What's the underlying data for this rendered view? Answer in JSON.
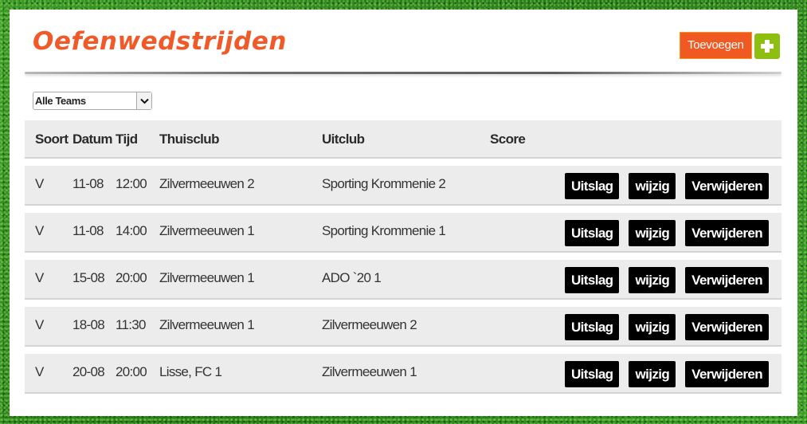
{
  "header": {
    "title": "Oefenwedstrijden",
    "add_button_label": "Toevoegen",
    "add_icon": "plus-icon"
  },
  "filter": {
    "selected": "Alle Teams",
    "arrow_icon": "chevron-down-icon"
  },
  "colors": {
    "title": "#f05a28",
    "add_button": "#f05a22",
    "plus_button": "#8cbf10",
    "action_button": "#000000",
    "row_bg": "#ececec"
  },
  "table": {
    "columns": [
      "Soort",
      "Datum",
      "Tijd",
      "Thuisclub",
      "Uitclub",
      "Score"
    ],
    "action_labels": {
      "result": "Uitslag",
      "edit": "wijzig",
      "delete": "Verwijderen"
    },
    "rows": [
      {
        "soort": "V",
        "datum": "11-08",
        "tijd": "12:00",
        "thuisclub": "Zilvermeeuwen 2",
        "uitclub": "Sporting Krommenie 2",
        "score": ""
      },
      {
        "soort": "V",
        "datum": "11-08",
        "tijd": "14:00",
        "thuisclub": "Zilvermeeuwen 1",
        "uitclub": "Sporting Krommenie 1",
        "score": ""
      },
      {
        "soort": "V",
        "datum": "15-08",
        "tijd": "20:00",
        "thuisclub": "Zilvermeeuwen 1",
        "uitclub": "ADO `20 1",
        "score": ""
      },
      {
        "soort": "V",
        "datum": "18-08",
        "tijd": "11:30",
        "thuisclub": "Zilvermeeuwen 1",
        "uitclub": "Zilvermeeuwen 2",
        "score": ""
      },
      {
        "soort": "V",
        "datum": "20-08",
        "tijd": "20:00",
        "thuisclub": "Lisse, FC 1",
        "uitclub": "Zilvermeeuwen 1",
        "score": ""
      }
    ]
  }
}
